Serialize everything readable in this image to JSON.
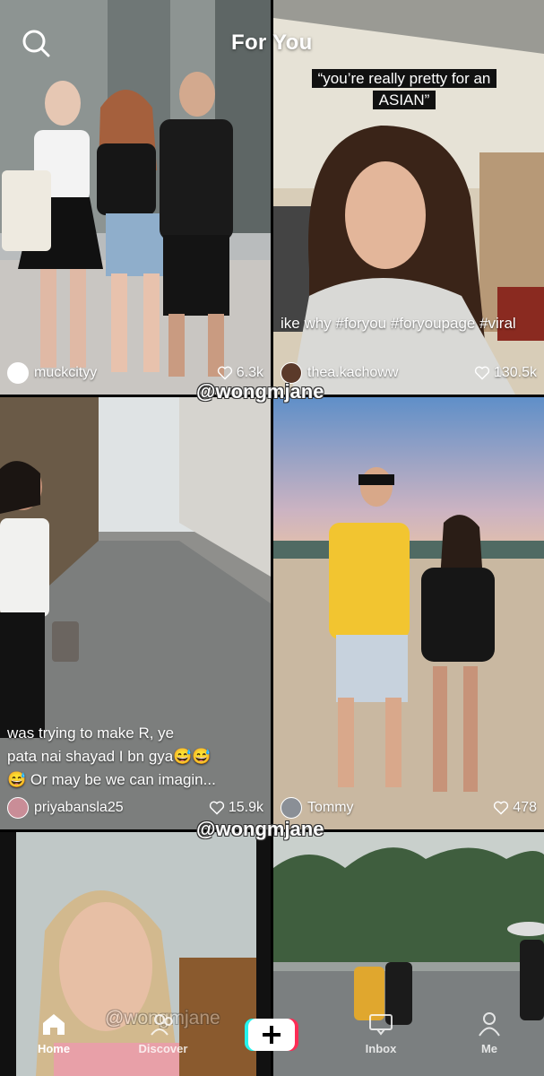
{
  "header": {
    "title": "For You"
  },
  "feed": [
    {
      "user": "muckcityy",
      "likes": "6.3k",
      "caption": ""
    },
    {
      "user": "thea.kachoww",
      "likes": "130.5k",
      "overlay_text": "“you’re really pretty for an ASIAN”",
      "caption": "ike why #foryou #foryoupage #viral"
    },
    {
      "user": "priyabansla25",
      "likes": "15.9k",
      "caption_lines": [
        "was trying to make R,  ye",
        "pata nai shayad I bn gya😅😅",
        "😅 Or may be we can imagin..."
      ]
    },
    {
      "user": "Tommy",
      "likes": "478",
      "caption": ""
    }
  ],
  "watermark": "@wongmjane",
  "nav": {
    "home": "Home",
    "discover": "Discover",
    "inbox": "Inbox",
    "me": "Me"
  },
  "colors": {
    "accent_red": "#fe2c55",
    "accent_cyan": "#25f4ee"
  },
  "icons": [
    "search-icon",
    "heart-icon",
    "home-icon",
    "discover-icon",
    "plus-icon",
    "inbox-icon",
    "me-icon"
  ]
}
